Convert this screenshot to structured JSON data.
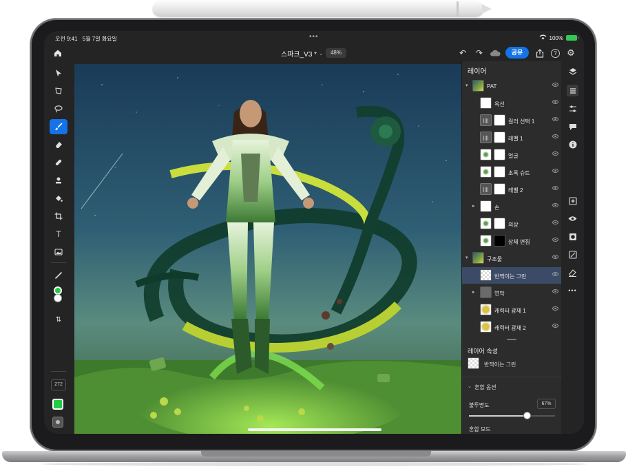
{
  "status": {
    "time": "오전 9:41",
    "date": "5월 7일 화요일",
    "battery": "100%"
  },
  "topbar": {
    "doc_title": "스파크_V3 *",
    "zoom": "48%",
    "share_label": "공유"
  },
  "tools": {
    "brush_size": "272",
    "foreground_color": "#22cc44",
    "fill_color": "#22cc44"
  },
  "layers_panel": {
    "title": "레이어",
    "layers": [
      {
        "name": "PAT",
        "thumb": "pic"
      },
      {
        "name": "옥선",
        "thumb": "white"
      },
      {
        "name": "컬러 선택 1",
        "thumb": "adj"
      },
      {
        "name": "레벨 1",
        "thumb": "adj"
      },
      {
        "name": "얼굴",
        "thumb": "fig"
      },
      {
        "name": "초록 슈트",
        "thumb": "fig"
      },
      {
        "name": "레벨 2",
        "thumb": "adj"
      },
      {
        "name": "손",
        "thumb": "white"
      },
      {
        "name": "의상",
        "thumb": "fig"
      },
      {
        "name": "상체 편집",
        "thumb": "fig"
      },
      {
        "name": "구조물",
        "thumb": "pic"
      },
      {
        "name": "반짝이는 그린",
        "thumb": "check"
      },
      {
        "name": "연막",
        "thumb": "grey"
      },
      {
        "name": "캐릭터 광채 1",
        "thumb": "gold"
      },
      {
        "name": "캐릭터 광채 2",
        "thumb": "gold"
      }
    ]
  },
  "properties": {
    "title": "레이어 속성",
    "layer_name": "반짝이는 그린",
    "blend_options": "혼합 옵션",
    "opacity_label": "불투명도",
    "opacity_value": "67%",
    "opacity_level": 0.67,
    "blend_mode_label": "혼합 모드"
  }
}
